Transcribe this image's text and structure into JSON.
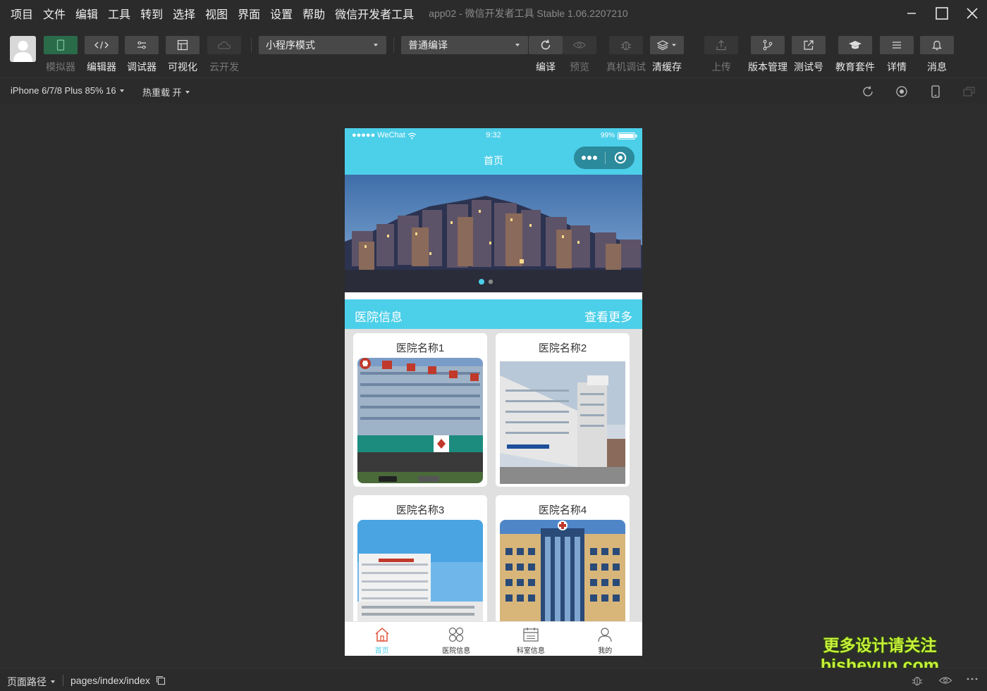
{
  "menubar": {
    "items": [
      "项目",
      "文件",
      "编辑",
      "工具",
      "转到",
      "选择",
      "视图",
      "界面",
      "设置",
      "帮助",
      "微信开发者工具"
    ],
    "app_title": "app02 - 微信开发者工具 Stable 1.06.2207210"
  },
  "toolbar": {
    "simulator": "模拟器",
    "editor": "编辑器",
    "debugger": "调试器",
    "visual": "可视化",
    "cloud": "云开发",
    "mode_select": "小程序模式",
    "compile_select": "普通编译",
    "compile": "编译",
    "preview": "预览",
    "remote_debug": "真机调试",
    "clear_cache": "清缓存",
    "upload": "上传",
    "version": "版本管理",
    "test_account": "测试号",
    "edu": "教育套件",
    "details": "详情",
    "messages": "消息"
  },
  "subbar": {
    "device": "iPhone 6/7/8 Plus 85% 16",
    "hot_reload": "热重载 开"
  },
  "phone": {
    "status": {
      "carrier": "●●●●● WeChat",
      "time": "9:32",
      "battery": "99%"
    },
    "nav_title": "首页",
    "section": {
      "title": "医院信息",
      "more": "查看更多"
    },
    "cards": [
      {
        "name": "医院名称1"
      },
      {
        "name": "医院名称2"
      },
      {
        "name": "医院名称3"
      },
      {
        "name": "医院名称4"
      }
    ],
    "tabs": [
      {
        "label": "首页",
        "icon": "home-icon"
      },
      {
        "label": "医院信息",
        "icon": "grid-icon"
      },
      {
        "label": "科室信息",
        "icon": "calendar-icon"
      },
      {
        "label": "我的",
        "icon": "user-icon"
      }
    ]
  },
  "bottombar": {
    "path_label": "页面路径",
    "path": "pages/index/index"
  },
  "watermark": {
    "line1": "更多设计请关注",
    "line2": "bisheyun.com"
  },
  "colors": {
    "accent": "#4ccfe9",
    "background": "#2d2d2d",
    "toolbar": "#2b2b2b"
  }
}
